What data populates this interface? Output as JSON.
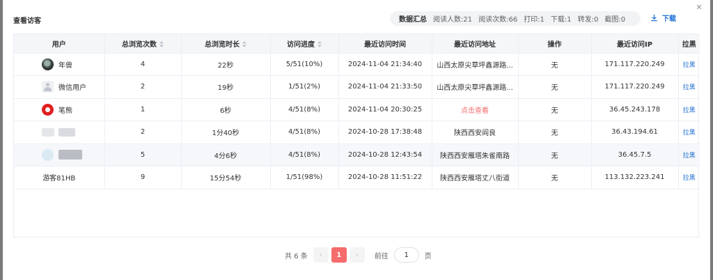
{
  "dialog": {
    "title": "查看访客",
    "close_icon": "close-icon"
  },
  "summary": {
    "label": "数据汇总",
    "readers": "阅读人数:21",
    "reads": "阅读次数:66",
    "prints": "打印:1",
    "downloads": "下载:1",
    "forwards": "转发:0",
    "screenshots": "截图:0"
  },
  "download": {
    "label": "下载",
    "icon": "download-icon"
  },
  "table": {
    "headers": [
      "用户",
      "总浏览次数",
      "总浏览时长",
      "访问进度",
      "最近访问时间",
      "最近访问地址",
      "操作",
      "最近访问IP",
      "拉黑"
    ],
    "rows": [
      {
        "user": "年兽",
        "visits": "4",
        "duration": "22秒",
        "progress": "5/51(10%)",
        "time": "2024-11-04 21:34:40",
        "address": "山西太原尖草坪鑫源路...",
        "op": "无",
        "ip": "171.117.220.249",
        "block": "拉黑"
      },
      {
        "user": "微信用户",
        "visits": "2",
        "duration": "19秒",
        "progress": "1/51(2%)",
        "time": "2024-11-04 21:33:50",
        "address": "山西太原尖草坪鑫源路...",
        "op": "无",
        "ip": "171.117.220.249",
        "block": "拉黑"
      },
      {
        "user": "笔熊",
        "visits": "1",
        "duration": "6秒",
        "progress": "4/51(8%)",
        "time": "2024-11-04 20:30:25",
        "address": "点击查看",
        "op": "无",
        "ip": "36.45.243.178",
        "block": "拉黑"
      },
      {
        "user": "",
        "visits": "2",
        "duration": "1分40秒",
        "progress": "4/51(8%)",
        "time": "2024-10-28 17:38:48",
        "address": "陕西西安阎良",
        "op": "无",
        "ip": "36.43.194.61",
        "block": "拉黑"
      },
      {
        "user": "",
        "visits": "5",
        "duration": "4分6秒",
        "progress": "4/51(8%)",
        "time": "2024-10-28 12:43:54",
        "address": "陕西西安雁塔朱雀南路",
        "op": "无",
        "ip": "36.45.7.5",
        "block": "拉黑"
      },
      {
        "user": "游客81HB",
        "visits": "9",
        "duration": "15分54秒",
        "progress": "1/51(98%)",
        "time": "2024-10-28 11:51:22",
        "address": "陕西西安雁塔丈八街道",
        "op": "无",
        "ip": "113.132.223.241",
        "block": "拉黑"
      }
    ]
  },
  "pagination": {
    "total": "共 6 条",
    "current": "1",
    "goto_prefix": "前往",
    "goto_value": "1",
    "goto_suffix": "页"
  }
}
